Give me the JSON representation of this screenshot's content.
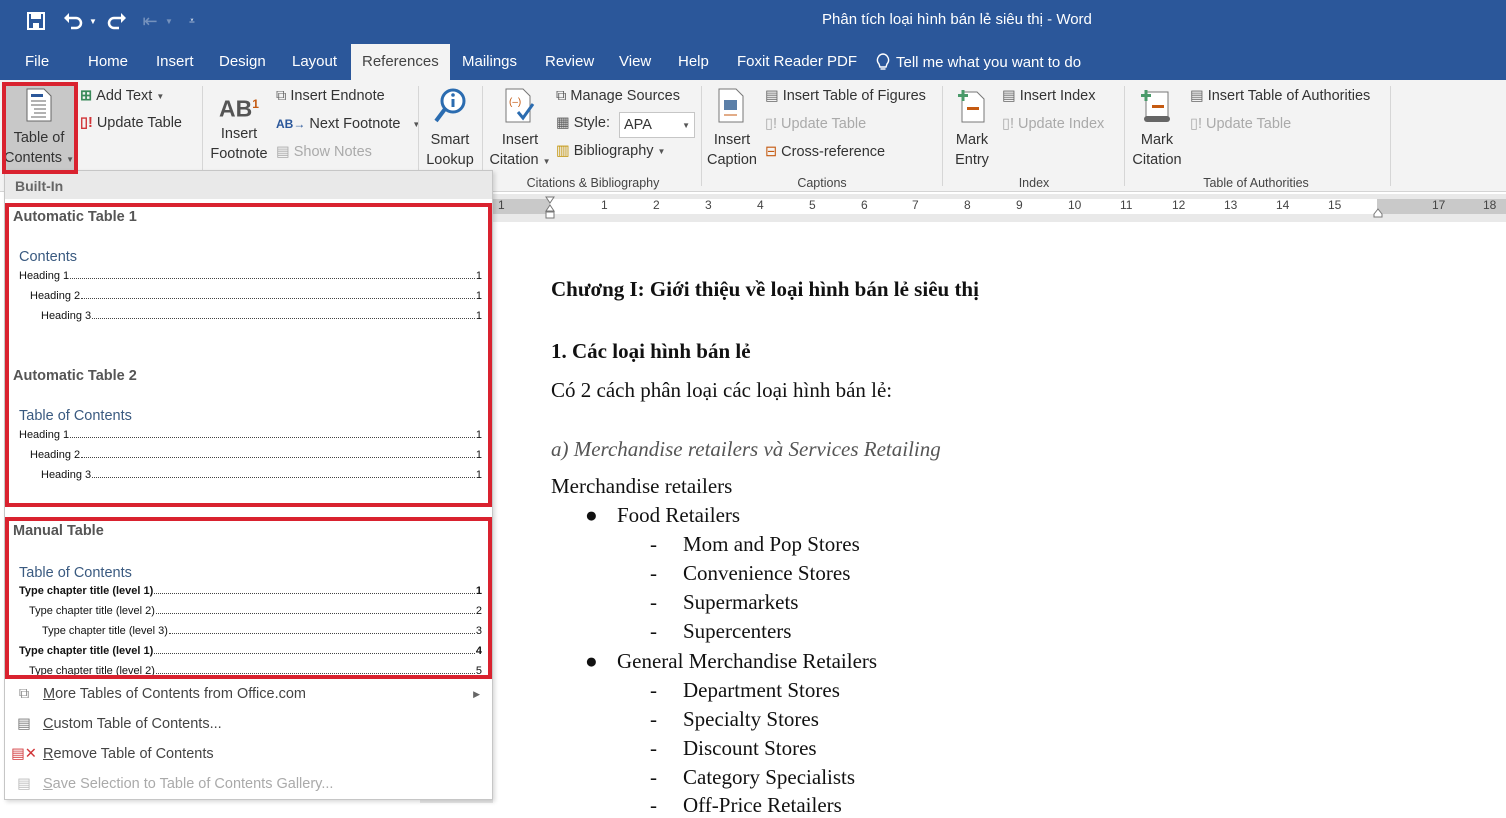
{
  "window": {
    "title": "Phân tích loại hình bán lẻ siêu thị  -  Word"
  },
  "quick_access": {
    "save": "save-icon",
    "undo": "undo-icon",
    "redo": "redo-icon",
    "customize": "customize-qat-icon"
  },
  "tabs": [
    {
      "label": "File"
    },
    {
      "label": "Home"
    },
    {
      "label": "Insert"
    },
    {
      "label": "Design"
    },
    {
      "label": "Layout"
    },
    {
      "label": "References",
      "active": true
    },
    {
      "label": "Mailings"
    },
    {
      "label": "Review"
    },
    {
      "label": "View"
    },
    {
      "label": "Help"
    },
    {
      "label": "Foxit Reader PDF"
    }
  ],
  "tell_me": "Tell me what you want to do",
  "ribbon": {
    "toc": {
      "label1": "Table of",
      "label2": "Contents",
      "add_text": "Add Text",
      "update_table": "Update Table"
    },
    "footnotes": {
      "insert1": "Insert",
      "insert2": "Footnote",
      "insert_endnote": "Insert Endnote",
      "next_footnote": "Next Footnote",
      "show_notes": "Show Notes"
    },
    "research": {
      "smart1": "Smart",
      "smart2": "Lookup"
    },
    "citations": {
      "insert1": "Insert",
      "insert2": "Citation",
      "manage_sources": "Manage Sources",
      "style_label": "Style:",
      "style_value": "APA",
      "bibliography": "Bibliography",
      "group": "Citations & Bibliography"
    },
    "captions": {
      "insert1": "Insert",
      "insert2": "Caption",
      "insert_tof": "Insert Table of Figures",
      "update_table": "Update Table",
      "cross_ref": "Cross-reference",
      "group": "Captions"
    },
    "index": {
      "mark1": "Mark",
      "mark2": "Entry",
      "insert_index": "Insert Index",
      "update_index": "Update Index",
      "group": "Index"
    },
    "authorities": {
      "mark1": "Mark",
      "mark2": "Citation",
      "insert_toa": "Insert Table of Authorities",
      "update_table": "Update Table",
      "group": "Table of Authorities"
    }
  },
  "ruler": {
    "ticks": [
      "1",
      "1",
      "2",
      "3",
      "4",
      "5",
      "6",
      "7",
      "8",
      "9",
      "10",
      "11",
      "12",
      "13",
      "14",
      "15",
      "17",
      "18"
    ]
  },
  "toc_menu": {
    "header": "Built-In",
    "galleries": [
      {
        "title": "Automatic Table 1",
        "heading": "Contents",
        "rows": [
          {
            "label": "Heading 1",
            "page": "1"
          },
          {
            "label": "Heading 2",
            "page": "1"
          },
          {
            "label": "Heading 3",
            "page": "1"
          }
        ]
      },
      {
        "title": "Automatic Table 2",
        "heading": "Table of Contents",
        "rows": [
          {
            "label": "Heading 1",
            "page": "1"
          },
          {
            "label": "Heading 2",
            "page": "1"
          },
          {
            "label": "Heading 3",
            "page": "1"
          }
        ]
      },
      {
        "title": "Manual Table",
        "heading": "Table of Contents",
        "rows": [
          {
            "label": "Type chapter title (level 1)",
            "page": "1"
          },
          {
            "label": "Type chapter title (level 2)",
            "page": "2"
          },
          {
            "label": "Type chapter title (level 3)",
            "page": "3"
          },
          {
            "label": "Type chapter title (level 1)",
            "page": "4"
          },
          {
            "label": "Type chapter title (level 2)",
            "page": "5"
          }
        ]
      }
    ],
    "items": [
      {
        "first": "M",
        "rest": "ore Tables of Contents from Office.com"
      },
      {
        "first": "C",
        "rest": "ustom Table of Contents..."
      },
      {
        "first": "R",
        "rest": "emove Table of Contents"
      },
      {
        "first": "S",
        "rest": "ave Selection to Table of Contents Gallery..."
      }
    ]
  },
  "document": {
    "chapter": "Chương I: Giới thiệu về loại hình bán lẻ siêu thị",
    "section": "1. Các loại hình bán lẻ",
    "intro": "Có 2 cách phân loại các loại hình bán lẻ:",
    "subsection": "a) Merchandise retailers và Services Retailing",
    "para": "Merchandise retailers",
    "list": [
      {
        "label": "Food Retailers",
        "children": [
          "Mom and Pop Stores",
          "Convenience Stores",
          "Supermarkets",
          "Supercenters"
        ]
      },
      {
        "label": "General Merchandise Retailers",
        "children": [
          "Department Stores",
          "Specialty Stores",
          "Discount Stores",
          "Category Specialists",
          "Off-Price Retailers"
        ]
      }
    ]
  }
}
